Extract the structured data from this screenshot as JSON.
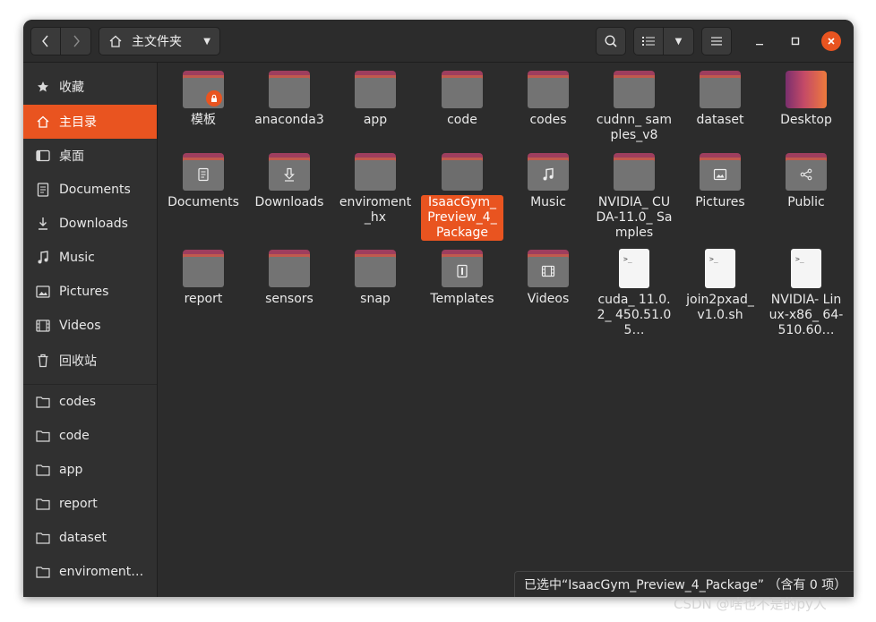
{
  "header": {
    "path_label": "主文件夹"
  },
  "sidebar": {
    "items": [
      {
        "label": "收藏",
        "icon": "star-icon"
      },
      {
        "label": "主目录",
        "icon": "home-icon",
        "active": true
      },
      {
        "label": "桌面",
        "icon": "desktop-icon"
      },
      {
        "label": "Documents",
        "icon": "document-icon"
      },
      {
        "label": "Downloads",
        "icon": "download-icon"
      },
      {
        "label": "Music",
        "icon": "music-icon"
      },
      {
        "label": "Pictures",
        "icon": "picture-icon"
      },
      {
        "label": "Videos",
        "icon": "video-icon"
      },
      {
        "label": "回收站",
        "icon": "trash-icon"
      }
    ],
    "bookmarks": [
      {
        "label": "codes",
        "icon": "folder-icon"
      },
      {
        "label": "code",
        "icon": "folder-icon"
      },
      {
        "label": "app",
        "icon": "folder-icon"
      },
      {
        "label": "report",
        "icon": "folder-icon"
      },
      {
        "label": "dataset",
        "icon": "folder-icon"
      },
      {
        "label": "enviroment…",
        "icon": "folder-icon"
      }
    ]
  },
  "files": [
    {
      "name": "模板",
      "kind": "folder-locked"
    },
    {
      "name": "anaconda3",
      "kind": "folder"
    },
    {
      "name": "app",
      "kind": "folder"
    },
    {
      "name": "code",
      "kind": "folder"
    },
    {
      "name": "codes",
      "kind": "folder"
    },
    {
      "name": "cudnn_ samples_v8",
      "kind": "folder"
    },
    {
      "name": "dataset",
      "kind": "folder"
    },
    {
      "name": "Desktop",
      "kind": "desktop"
    },
    {
      "name": "Documents",
      "kind": "folder-documents"
    },
    {
      "name": "Downloads",
      "kind": "folder-downloads"
    },
    {
      "name": "enviroment _hx",
      "kind": "folder"
    },
    {
      "name": "IsaacGym_ Preview_4_ Package",
      "kind": "folder",
      "selected": true
    },
    {
      "name": "Music",
      "kind": "folder-music"
    },
    {
      "name": "NVIDIA_ CUDA-11.0_ Samples",
      "kind": "folder"
    },
    {
      "name": "Pictures",
      "kind": "folder-pictures"
    },
    {
      "name": "Public",
      "kind": "folder-public"
    },
    {
      "name": "report",
      "kind": "folder"
    },
    {
      "name": "sensors",
      "kind": "folder"
    },
    {
      "name": "snap",
      "kind": "folder"
    },
    {
      "name": "Templates",
      "kind": "folder-templates"
    },
    {
      "name": "Videos",
      "kind": "folder-videos"
    },
    {
      "name": "cuda_ 11.0.2_ 450.51.05…",
      "kind": "script"
    },
    {
      "name": "join2pxad_ v1.0.sh",
      "kind": "script"
    },
    {
      "name": "NVIDIA- Linux-x86_ 64-510.60…",
      "kind": "script"
    }
  ],
  "status": {
    "text": "已选中“IsaacGym_Preview_4_Package” （含有 0 项）"
  },
  "watermark": "CSDN @啥也不是的py人",
  "colors": {
    "accent": "#e95420",
    "window_bg": "#2c2c2c",
    "sidebar_bg": "#303030",
    "folder_body": "#737373",
    "folder_tab": "#9e3e5e"
  }
}
